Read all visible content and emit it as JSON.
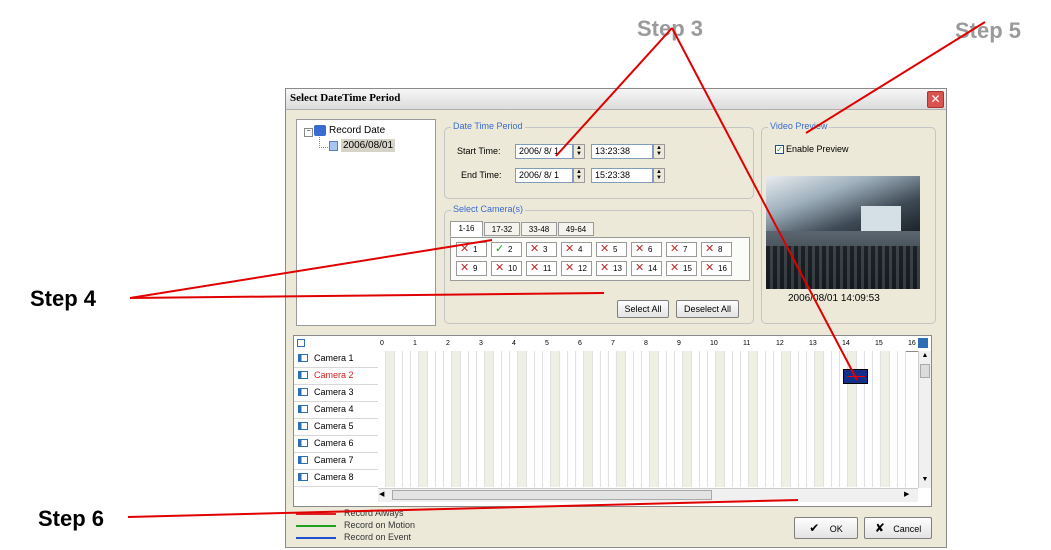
{
  "annotations": {
    "step3": "Step 3",
    "step4": "Step 4",
    "step5": "Step 5",
    "step6": "Step 6"
  },
  "dialog": {
    "title": "Select DateTime Period",
    "close_icon": "close-icon"
  },
  "record_tree": {
    "root_label": "Record Date",
    "child_label": "2006/08/01"
  },
  "date_time_period": {
    "legend": "Date Time Period",
    "start_label": "Start Time:",
    "start_date": "2006/ 8/ 1",
    "start_time": "13:23:38",
    "end_label": "End Time:",
    "end_date": "2006/ 8/ 1",
    "end_time": "15:23:38"
  },
  "select_cameras": {
    "legend": "Select Camera(s)",
    "tabs": [
      "1-16",
      "17-32",
      "33-48",
      "49-64"
    ],
    "cameras": [
      {
        "num": "1",
        "checked": false
      },
      {
        "num": "2",
        "checked": true
      },
      {
        "num": "3",
        "checked": false
      },
      {
        "num": "4",
        "checked": false
      },
      {
        "num": "5",
        "checked": false
      },
      {
        "num": "6",
        "checked": false
      },
      {
        "num": "7",
        "checked": false
      },
      {
        "num": "8",
        "checked": false
      },
      {
        "num": "9",
        "checked": false
      },
      {
        "num": "10",
        "checked": false
      },
      {
        "num": "11",
        "checked": false
      },
      {
        "num": "12",
        "checked": false
      },
      {
        "num": "13",
        "checked": false
      },
      {
        "num": "14",
        "checked": false
      },
      {
        "num": "15",
        "checked": false
      },
      {
        "num": "16",
        "checked": false
      }
    ],
    "select_all": "Select All",
    "deselect_all": "Deselect All"
  },
  "video_preview": {
    "legend": "Video Preview",
    "enable_label": "Enable Preview",
    "enable_checked": true,
    "timestamp": "2006/08/01 14:09:53"
  },
  "timeline": {
    "hours": [
      "0",
      "1",
      "2",
      "3",
      "4",
      "5",
      "6",
      "7",
      "8",
      "9",
      "10",
      "11",
      "12",
      "13",
      "14",
      "15",
      "16"
    ],
    "cameras": [
      "Camera 1",
      "Camera 2",
      "Camera 3",
      "Camera 4",
      "Camera 5",
      "Camera 6",
      "Camera 7",
      "Camera 8"
    ],
    "selected_camera": "Camera 2"
  },
  "legend": {
    "items": [
      {
        "label": "Record Always",
        "color": "#e02020"
      },
      {
        "label": "Record on Motion",
        "color": "#22a022"
      },
      {
        "label": "Record on Event",
        "color": "#2050d0"
      }
    ]
  },
  "buttons": {
    "ok": "OK",
    "cancel": "Cancel"
  },
  "colors": {
    "callout_line": "#e00000",
    "accent": "#3a6bd0"
  }
}
